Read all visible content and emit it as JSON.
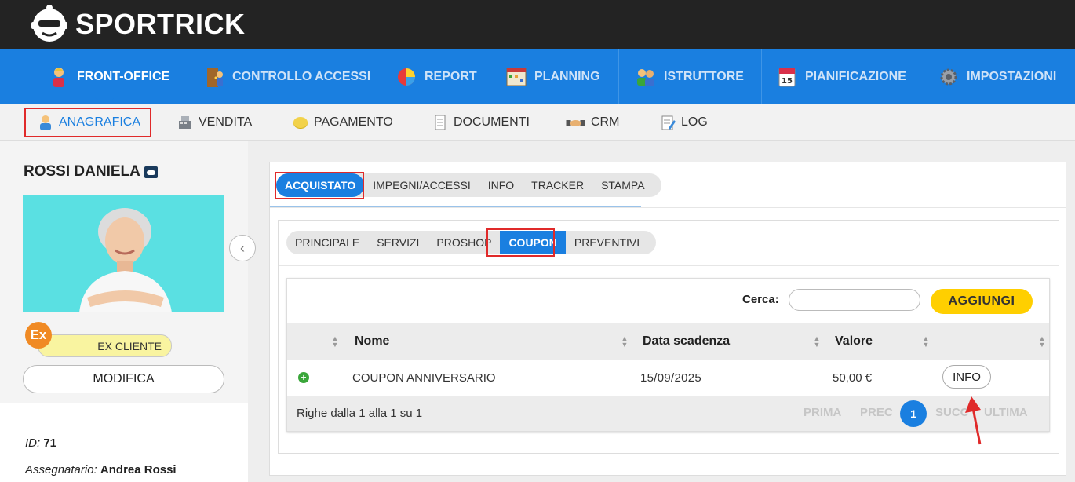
{
  "app": {
    "logo_text": "SPORTRICK"
  },
  "main_nav": [
    {
      "label": "FRONT-OFFICE",
      "icon": "user-icon",
      "active": true
    },
    {
      "label": "CONTROLLO ACCESSI",
      "icon": "door-icon"
    },
    {
      "label": "REPORT",
      "icon": "pie-chart-icon"
    },
    {
      "label": "PLANNING",
      "icon": "calendar-grid-icon"
    },
    {
      "label": "ISTRUTTORE",
      "icon": "instructors-icon"
    },
    {
      "label": "PIANIFICAZIONE",
      "icon": "calendar-15-icon"
    },
    {
      "label": "IMPOSTAZIONI",
      "icon": "gear-icon"
    }
  ],
  "sub_nav": [
    {
      "label": "ANAGRAFICA",
      "icon": "person-icon",
      "active": true
    },
    {
      "label": "VENDITA",
      "icon": "cash-register-icon"
    },
    {
      "label": "PAGAMENTO",
      "icon": "coin-icon"
    },
    {
      "label": "DOCUMENTI",
      "icon": "document-icon"
    },
    {
      "label": "CRM",
      "icon": "handshake-icon"
    },
    {
      "label": "LOG",
      "icon": "log-icon"
    }
  ],
  "customer": {
    "name": "ROSSI DANIELA",
    "status_badge": "Ex",
    "status_label": "EX CLIENTE",
    "edit_label": "MODIFICA",
    "id_label": "ID:",
    "id_value": "71",
    "assignee_label": "Assegnatario:",
    "assignee_value": "Andrea Rossi"
  },
  "tabs_primary": [
    "ACQUISTATO",
    "IMPEGNI/ACCESSI",
    "INFO",
    "TRACKER",
    "STAMPA"
  ],
  "tabs_secondary": [
    "PRINCIPALE",
    "SERVIZI",
    "PROSHOP",
    "COUPON",
    "PREVENTIVI"
  ],
  "table": {
    "search_label": "Cerca:",
    "search_value": "",
    "add_label": "AGGIUNGI",
    "columns": [
      "Nome",
      "Data scadenza",
      "Valore"
    ],
    "rows": [
      {
        "name": "COUPON ANNIVERSARIO",
        "expiry": "15/09/2025",
        "value": "50,00 €",
        "action": "INFO"
      }
    ],
    "footer_info": "Righe dalla 1 alla 1 su 1",
    "pagination": {
      "first": "PRIMA",
      "prev": "PREC",
      "current": "1",
      "next": "SUCC",
      "last": "ULTIMA"
    }
  },
  "colors": {
    "header": "#232323",
    "nav": "#1a7fe0",
    "accent_yellow": "#ffcf00",
    "highlight_red": "#e02a2a",
    "status_orange": "#f08a24"
  }
}
